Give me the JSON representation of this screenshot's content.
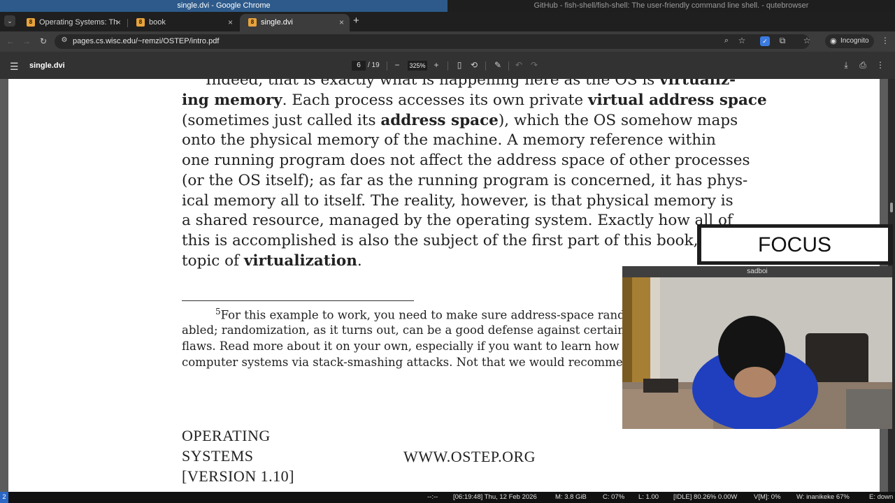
{
  "window": {
    "left_title": "single.dvi - Google Chrome",
    "right_title": "GitHub - fish-shell/fish-shell: The user-friendly command line shell. - qutebrowser"
  },
  "tabs": [
    {
      "label": "Operating Systems: Th",
      "close": "×"
    },
    {
      "label": "book",
      "close": "×"
    },
    {
      "label": "single.dvi",
      "close": "×"
    }
  ],
  "tab_search_icon": "⌄",
  "new_tab": "+",
  "toolbar": {
    "url": "pages.cs.wisc.edu/~remzi/OSTEP/intro.pdf",
    "incognito": "Incognito",
    "icons": [
      "back-icon",
      "forward-icon",
      "reload-icon",
      "site-info-icon",
      "zoom-icon",
      "star-icon",
      "extension-icon",
      "puzzle-icon",
      "bookmarks-icon",
      "incognito-icon",
      "menu-icon"
    ]
  },
  "pdf": {
    "menu_icon": "☰",
    "title": "single.dvi",
    "page_current": "6",
    "page_total": "/ 19",
    "zoom": "325%",
    "zoom_out": "−",
    "zoom_in": "+"
  },
  "doc": {
    "lines": [
      {
        "parts": [
          {
            "t": "Indeed, that is exactly what is happening here as the OS is "
          },
          {
            "t": "virtualiz-",
            "b": true
          }
        ]
      },
      {
        "parts": [
          {
            "t": "ing memory",
            "b": true
          },
          {
            "t": ". Each process accesses its own private "
          },
          {
            "t": "virtual address space",
            "b": true
          }
        ]
      },
      {
        "parts": [
          {
            "t": "(sometimes just called its "
          },
          {
            "t": "address space",
            "b": true
          },
          {
            "t": "), which the OS somehow maps"
          }
        ]
      },
      {
        "parts": [
          {
            "t": "onto the physical memory of the machine. A memory reference within"
          }
        ]
      },
      {
        "parts": [
          {
            "t": "one running program does not affect the address space of other processes"
          }
        ]
      },
      {
        "parts": [
          {
            "t": "(or the OS itself); as far as the running program is concerned, it has phys-"
          }
        ]
      },
      {
        "parts": [
          {
            "t": "ical memory all to itself. The reality, however, is that physical memory is"
          }
        ]
      },
      {
        "parts": [
          {
            "t": "a shared resource, managed by the operating system. Exactly how all of"
          }
        ]
      },
      {
        "parts": [
          {
            "t": "this is accomplished is also the subject of the first part of this book, on the"
          }
        ]
      },
      {
        "parts": [
          {
            "t": "topic of "
          },
          {
            "t": "virtualization",
            "b": true
          },
          {
            "t": "."
          }
        ]
      }
    ],
    "footnote_mark": "5",
    "footnote_lines": [
      "For this example to work, you need to make sure address-space randomization is dis-",
      "abled; randomization, as it turns out, can be a good defense against certain kinds of security",
      "flaws. Read more about it on your own, especially if you want to learn how to break into",
      "computer systems via stack-smashing attacks. Not that we would recommend such a thing..."
    ],
    "footer_left": [
      "OPERATING",
      "SYSTEMS",
      "[VERSION 1.10]"
    ],
    "footer_center": "WWW.OSTEP.ORG"
  },
  "overlay": {
    "focus": "FOCUS",
    "cam_title": "sadboi"
  },
  "statusbar": {
    "workspace": "2",
    "items": [
      "--:--",
      "[06:19:48] Thu, 12 Feb 2026",
      "M: 3.8 GiB",
      "C: 07%",
      "L: 1.00",
      "[IDLE] 80.26% 0.00W",
      "V[M]: 0%",
      "W: inanikeke  67%",
      "E: down"
    ]
  }
}
